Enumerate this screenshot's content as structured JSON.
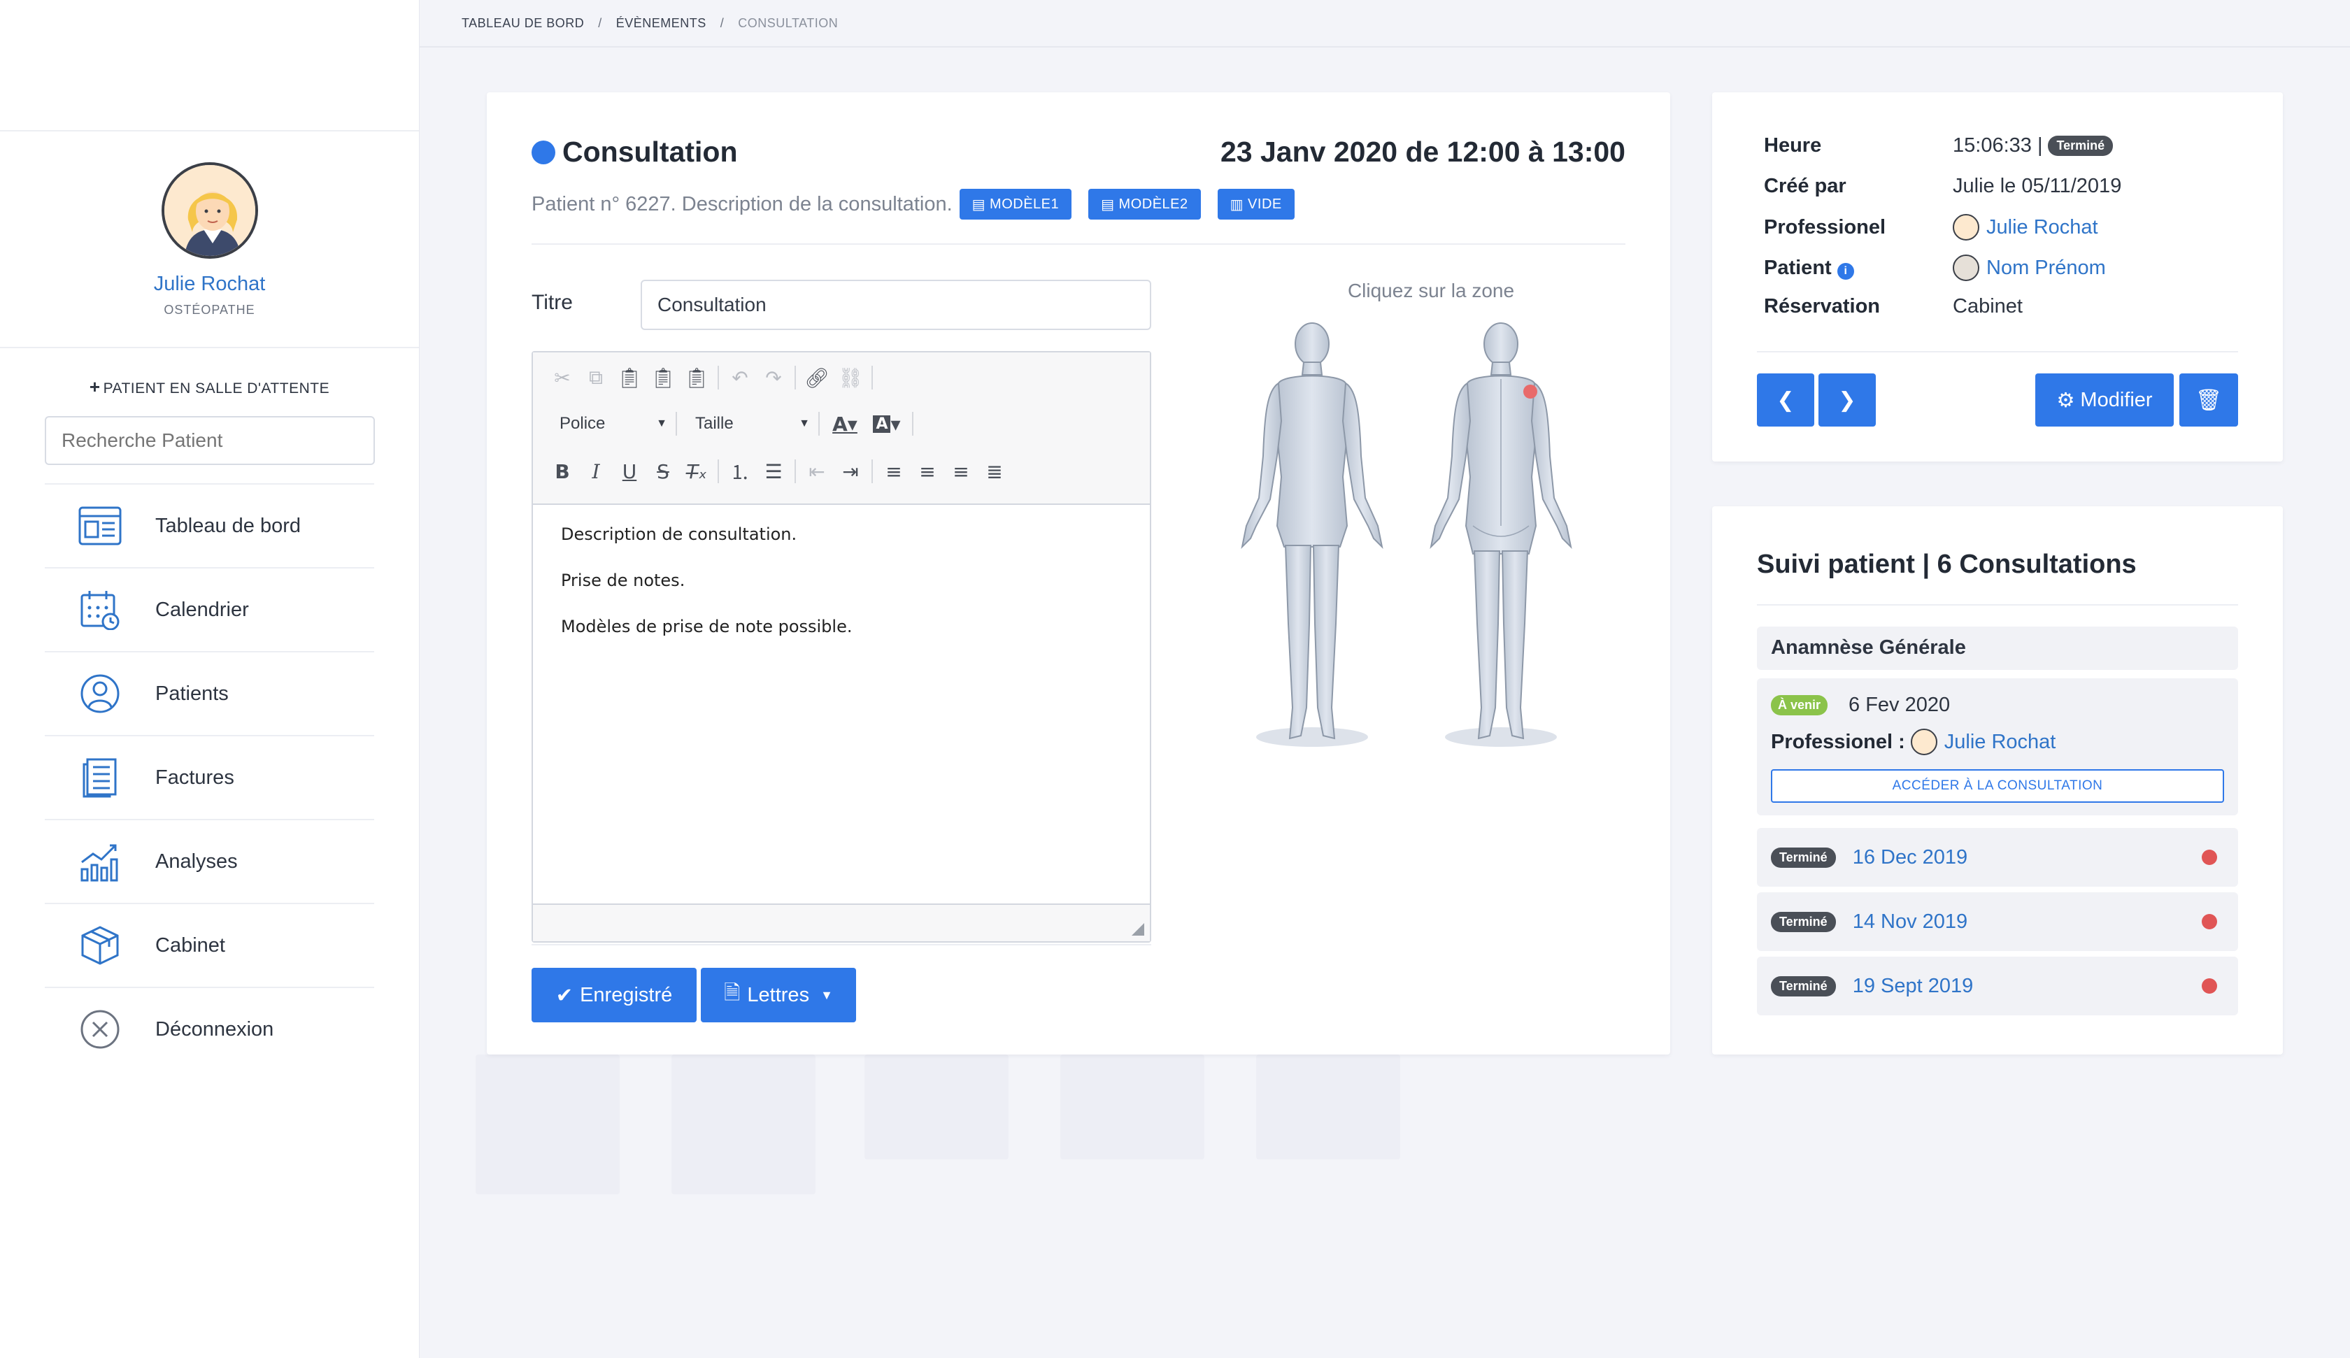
{
  "breadcrumb": [
    "TABLEAU DE BORD",
    "ÉVÈNEMENTS",
    "CONSULTATION"
  ],
  "breadcrumb_sep": "/",
  "sidebar": {
    "user_name": "Julie Rochat",
    "user_role": "OSTÉOPATHE",
    "waiting_room_label": "PATIENT EN SALLE D'ATTENTE",
    "search_placeholder": "Recherche Patient",
    "items": [
      {
        "label": "Tableau de bord",
        "icon": "dashboard-icon"
      },
      {
        "label": "Calendrier",
        "icon": "calendar-icon"
      },
      {
        "label": "Patients",
        "icon": "user-icon"
      },
      {
        "label": "Factures",
        "icon": "invoice-icon"
      },
      {
        "label": "Analyses",
        "icon": "chart-icon"
      },
      {
        "label": "Cabinet",
        "icon": "box-icon"
      },
      {
        "label": "Déconnexion",
        "icon": "logout-icon"
      }
    ]
  },
  "consultation": {
    "title": "Consultation",
    "datetime": "23 Janv 2020 de 12:00 à 13:00",
    "subtitle": "Patient n° 6227. Description de la consultation.",
    "template_buttons": [
      "MODÈLE1",
      "MODÈLE2",
      "VIDE"
    ],
    "titre_label": "Titre",
    "titre_value": "Consultation",
    "toolbar": {
      "font_label": "Police",
      "size_label": "Taille"
    },
    "editor_lines": [
      "Description de consultation.",
      "Prise de notes.",
      "Modèles de prise de note possible."
    ],
    "body_hint": "Cliquez sur la zone",
    "save_label": "Enregistré",
    "letters_label": "Lettres"
  },
  "info": {
    "rows": [
      {
        "key": "Heure",
        "value": "15:06:33 |",
        "badge": "Terminé"
      },
      {
        "key": "Créé par",
        "value": "Julie le 05/11/2019"
      },
      {
        "key": "Professionel",
        "value": "Julie Rochat"
      },
      {
        "key": "Patient",
        "value": "Nom Prénom"
      },
      {
        "key": "Réservation",
        "value": "Cabinet"
      }
    ],
    "modify_label": "Modifier"
  },
  "suivi": {
    "title": "Suivi patient | 6 Consultations",
    "section": "Anamnèse Générale",
    "upcoming": {
      "badge": "À venir",
      "date": "6 Fev 2020",
      "pro_label": "Professionel :",
      "pro_name": "Julie Rochat",
      "access_label": "ACCÉDER À LA CONSULTATION"
    },
    "past": [
      {
        "badge": "Terminé",
        "date": "16 Dec 2019"
      },
      {
        "badge": "Terminé",
        "date": "14 Nov 2019"
      },
      {
        "badge": "Terminé",
        "date": "19 Sept 2019"
      }
    ]
  },
  "colors": {
    "accent": "#2f78e8",
    "link": "#2f74c8",
    "done_badge": "#4a4f57",
    "upcoming_badge": "#8bc34a",
    "alert_dot": "#e05555"
  }
}
